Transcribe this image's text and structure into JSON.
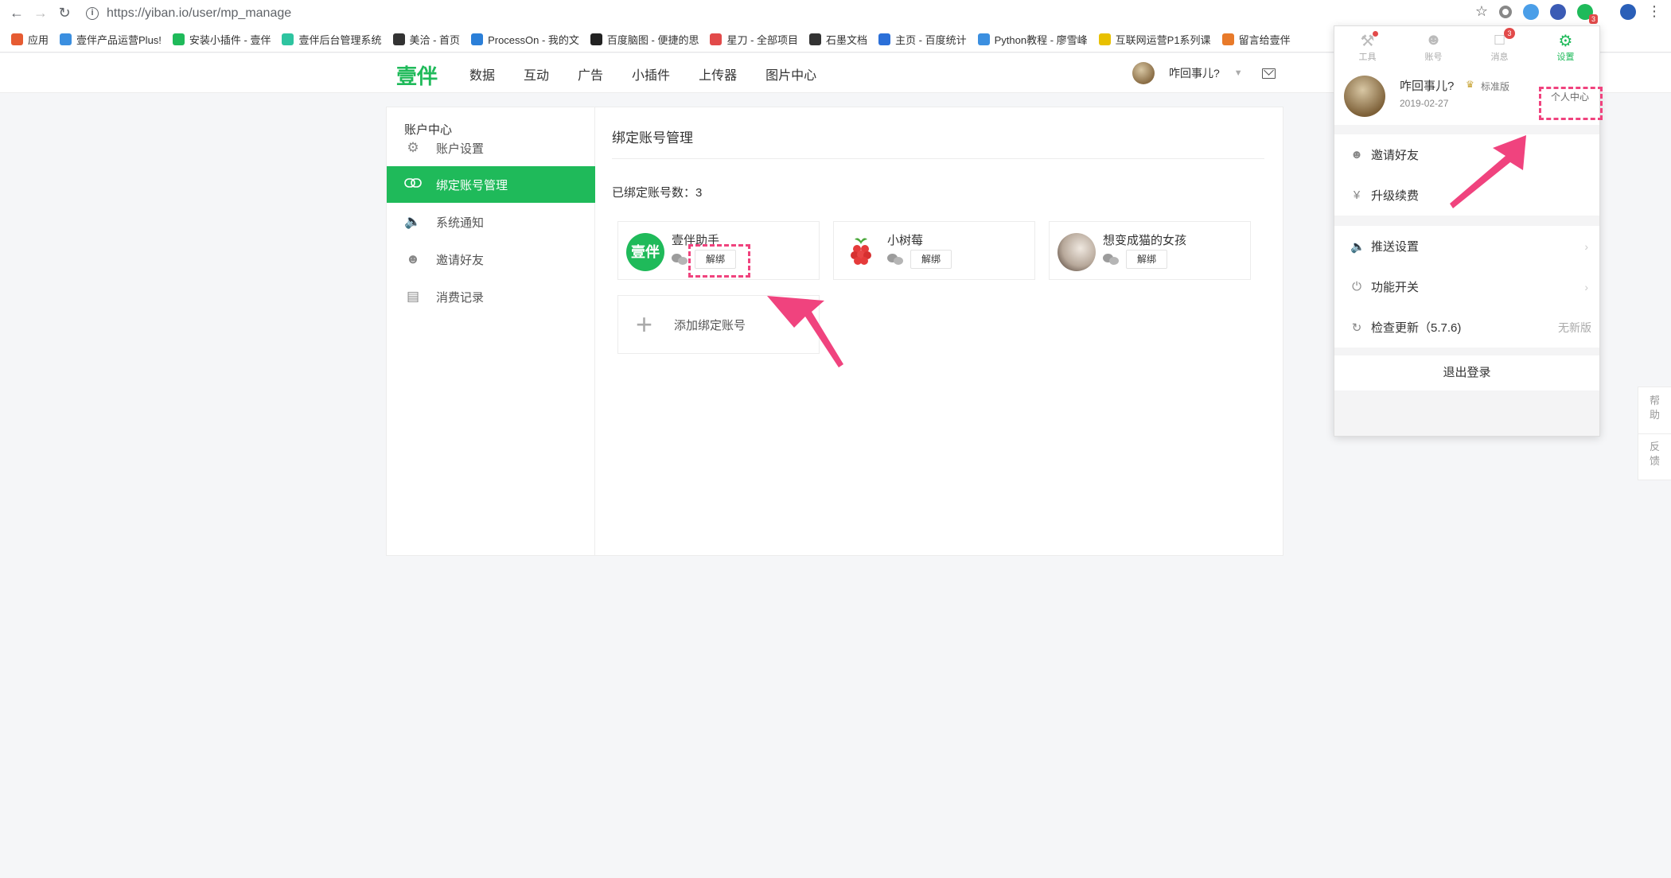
{
  "browser": {
    "url": "https://yiban.io/user/mp_manage",
    "bookmarks": [
      {
        "label": "应用",
        "color": "#e65b32"
      },
      {
        "label": "壹伴产品运营Plus!",
        "color": "#3b8fe0"
      },
      {
        "label": "安装小插件 - 壹伴",
        "color": "#1fba5a"
      },
      {
        "label": "壹伴后台管理系统",
        "color": "#2ec4a0"
      },
      {
        "label": "美洽 - 首页",
        "color": "#333333"
      },
      {
        "label": "ProcessOn - 我的文",
        "color": "#2b7fd8"
      },
      {
        "label": "百度脑图 - 便捷的思",
        "color": "#222222"
      },
      {
        "label": "星刀 - 全部项目",
        "color": "#e24a4a"
      },
      {
        "label": "石墨文档",
        "color": "#333333"
      },
      {
        "label": "主页 - 百度统计",
        "color": "#2b6fd8"
      },
      {
        "label": "Python教程 - 廖雪峰",
        "color": "#3b8fe0"
      },
      {
        "label": "互联网运营P1系列课",
        "color": "#e8c000"
      },
      {
        "label": "留言给壹伴",
        "color": "#e87a2a"
      }
    ],
    "ext_badge": "3"
  },
  "header": {
    "logo": "壹伴",
    "nav": [
      "数据",
      "互动",
      "广告",
      "小插件",
      "上传器",
      "图片中心"
    ],
    "username": "咋回事儿?"
  },
  "sidebar": {
    "title": "账户中心",
    "items": [
      {
        "label": "账户设置",
        "icon": "gear-icon",
        "active": false
      },
      {
        "label": "绑定账号管理",
        "icon": "link-icon",
        "active": true
      },
      {
        "label": "系统通知",
        "icon": "speaker-icon",
        "active": false
      },
      {
        "label": "邀请好友",
        "icon": "user-plus-icon",
        "active": false
      },
      {
        "label": "消费记录",
        "icon": "receipt-icon",
        "active": false
      }
    ]
  },
  "content": {
    "title": "绑定账号管理",
    "bound_count": "已绑定账号数：3",
    "accounts": [
      {
        "name": "壹伴助手",
        "avatar_text": "壹伴",
        "unbind": "解绑"
      },
      {
        "name": "小树莓",
        "unbind": "解绑"
      },
      {
        "name": "想变成猫的女孩",
        "unbind": "解绑"
      }
    ],
    "add_label": "添加绑定账号"
  },
  "dropdown": {
    "tabs": [
      {
        "label": "工具",
        "icon": "tools-icon"
      },
      {
        "label": "账号",
        "icon": "user-icon"
      },
      {
        "label": "消息",
        "icon": "message-icon",
        "badge": "3"
      },
      {
        "label": "设置",
        "icon": "settings-icon"
      }
    ],
    "user": {
      "name": "咋回事儿?",
      "edition": "标准版",
      "date": "2019-02-27",
      "center_link": "个人中心"
    },
    "items_a": [
      "邀请好友",
      "升级续费"
    ],
    "items_b": [
      "推送设置",
      "功能开关",
      "检查更新（5.7.6)"
    ],
    "update_status": "无新版",
    "logout": "退出登录"
  },
  "help_tab": {
    "help": "帮助",
    "feedback": "反馈"
  },
  "colors": {
    "brand": "#1fba5a",
    "highlight": "#f0437e"
  }
}
